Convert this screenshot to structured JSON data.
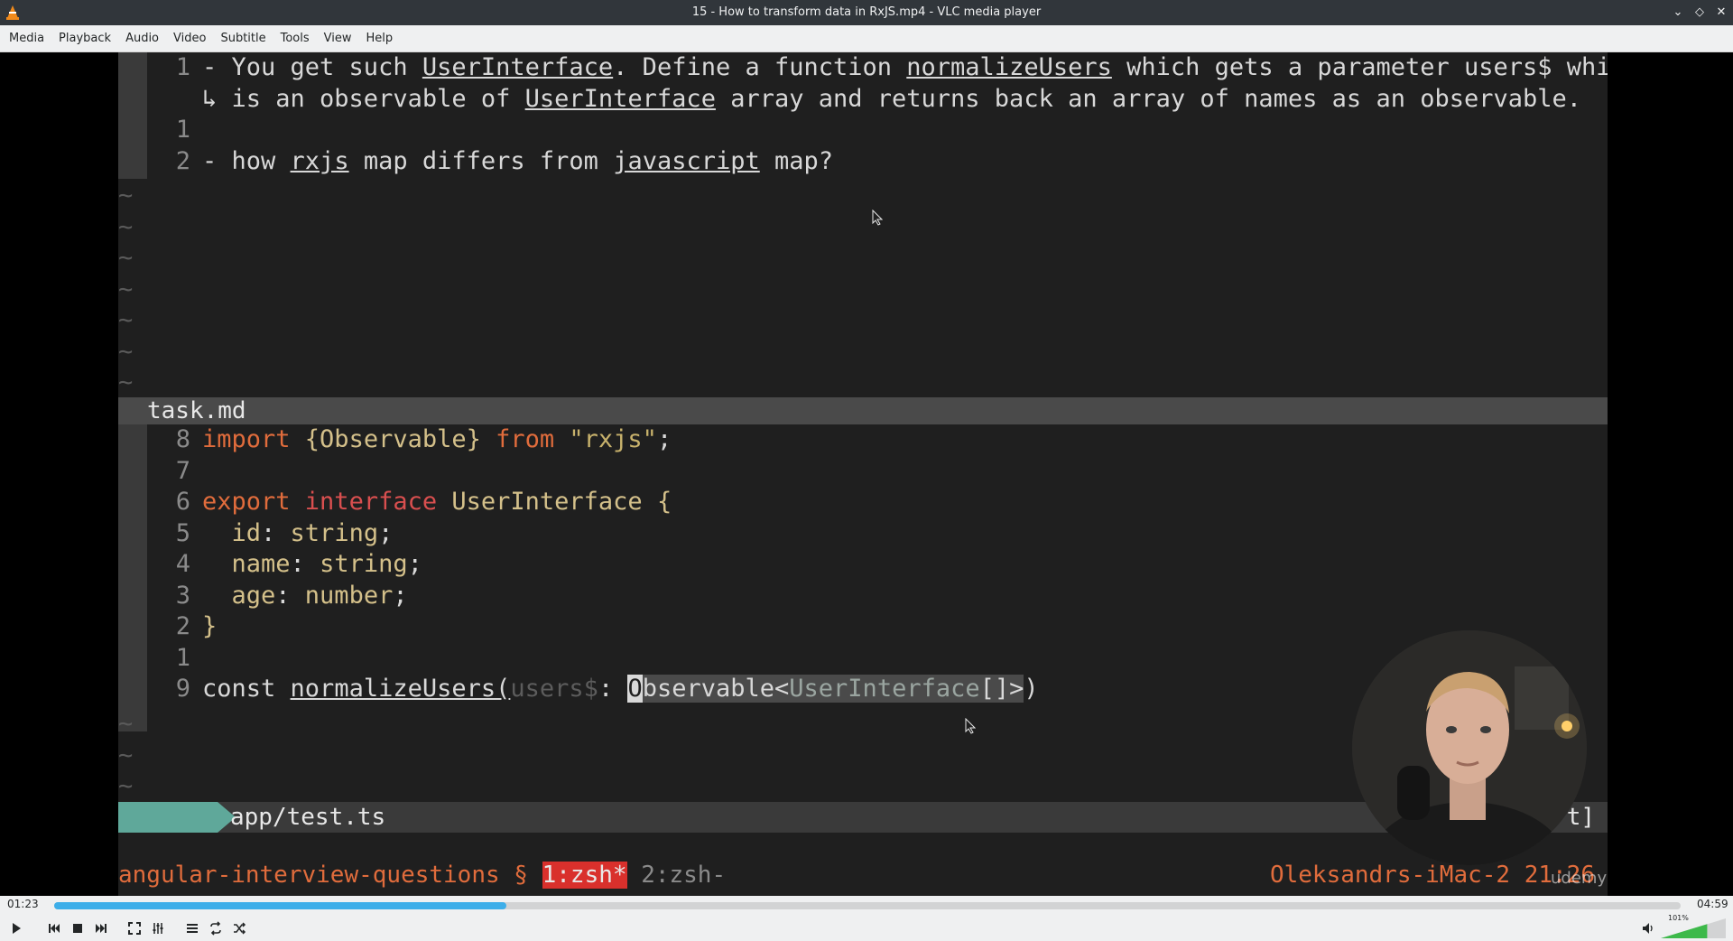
{
  "window": {
    "title": "15 - How to transform data in RxJS.mp4 - VLC media player"
  },
  "menu": [
    "Media",
    "Playback",
    "Audio",
    "Video",
    "Subtitle",
    "Tools",
    "View",
    "Help"
  ],
  "editor_top": {
    "lines": [
      {
        "num": "1",
        "parts": [
          {
            "t": "- You get such "
          },
          {
            "t": "UserInterface",
            "u": true
          },
          {
            "t": ". Define a function "
          },
          {
            "t": "normalizeUsers",
            "u": true
          },
          {
            "t": " which gets a parameter users$ which"
          }
        ]
      },
      {
        "num": "",
        "parts": [
          {
            "t": "↳ is an observable of "
          },
          {
            "t": "UserInterface",
            "u": true
          },
          {
            "t": " array and returns back an array of names as an observable."
          }
        ]
      },
      {
        "num": "1",
        "parts": []
      },
      {
        "num": "2",
        "parts": [
          {
            "t": "- how "
          },
          {
            "t": "rxjs",
            "u": true
          },
          {
            "t": " map differs from "
          },
          {
            "t": "javascript",
            "u": true
          },
          {
            "t": " map?"
          }
        ]
      }
    ],
    "filename": "task.md"
  },
  "editor_bottom": {
    "lines": [
      {
        "num": "8",
        "parts": [
          {
            "t": "import ",
            "c": "kw"
          },
          {
            "t": "{Observable} ",
            "c": "ty"
          },
          {
            "t": "from ",
            "c": "kw"
          },
          {
            "t": "\"rxjs\"",
            "c": "str"
          },
          {
            "t": ";"
          }
        ]
      },
      {
        "num": "7",
        "parts": []
      },
      {
        "num": "6",
        "parts": [
          {
            "t": "export ",
            "c": "kw"
          },
          {
            "t": "interface ",
            "c": "kw2"
          },
          {
            "t": "UserInterface ",
            "c": "ty"
          },
          {
            "t": "{",
            "c": "ty"
          }
        ]
      },
      {
        "num": "5",
        "parts": [
          {
            "t": "  id",
            "c": "ty"
          },
          {
            "t": ": "
          },
          {
            "t": "string",
            "c": "ty"
          },
          {
            "t": ";"
          }
        ]
      },
      {
        "num": "4",
        "parts": [
          {
            "t": "  name",
            "c": "ty"
          },
          {
            "t": ": "
          },
          {
            "t": "string",
            "c": "ty"
          },
          {
            "t": ";"
          }
        ]
      },
      {
        "num": "3",
        "parts": [
          {
            "t": "  age",
            "c": "ty"
          },
          {
            "t": ": "
          },
          {
            "t": "number",
            "c": "ty"
          },
          {
            "t": ";"
          }
        ]
      },
      {
        "num": "2",
        "parts": [
          {
            "t": "}",
            "c": "ty"
          }
        ]
      },
      {
        "num": "1",
        "parts": []
      },
      {
        "num": "9",
        "error": "✖",
        "parts": [
          {
            "t": "const "
          },
          {
            "t": "normalizeUsers(",
            "u": true
          },
          {
            "t": "users$",
            "c": "dim"
          },
          {
            "t": ": "
          },
          {
            "t": "O",
            "c": "cursor"
          },
          {
            "t": "bservable<",
            "c": "sel"
          },
          {
            "t": "UserInterface",
            "c": "selty"
          },
          {
            "t": "[]>",
            "c": "sel"
          },
          {
            "t": ")"
          }
        ]
      }
    ],
    "filename": "app/test.ts",
    "status_right": "t]"
  },
  "tmux": {
    "session": "angular-interview-questions",
    "separator": "§",
    "active_window": "1:zsh*",
    "inactive_window": "2:zsh-",
    "host": "Oleksandrs-iMac-2",
    "clock": "21:26"
  },
  "watermark": "udemy",
  "player": {
    "elapsed": "01:23",
    "total": "04:59",
    "progress_fraction": 0.278,
    "volume_label": "101%",
    "volume_fraction": 0.84
  }
}
